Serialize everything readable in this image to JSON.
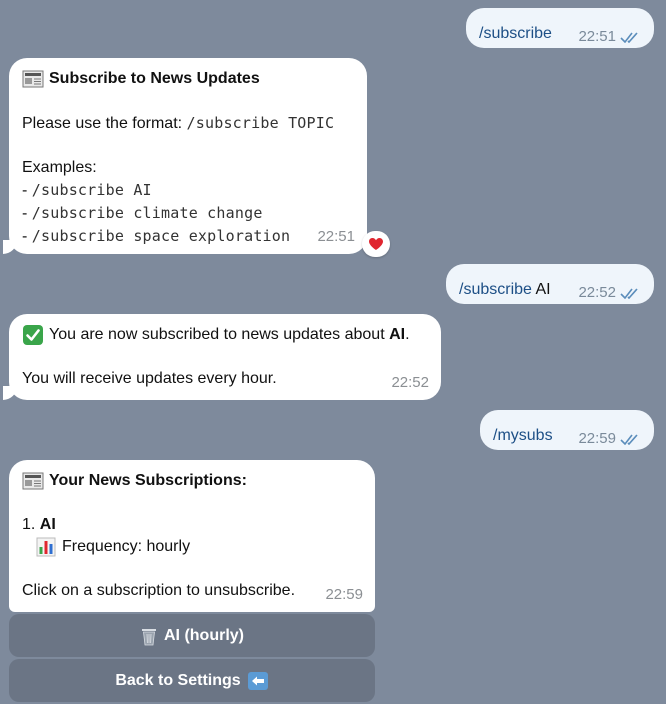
{
  "messages": {
    "m1": {
      "text": "/subscribe",
      "time": "22:51"
    },
    "m2": {
      "title": "Subscribe to News Updates",
      "intro": "Please use the format: ",
      "format": "/subscribe TOPIC",
      "examples_label": "Examples:",
      "examples": [
        "/subscribe AI",
        "/subscribe climate change",
        "/subscribe space exploration"
      ],
      "time": "22:51",
      "reaction": "heart"
    },
    "m3": {
      "command": "/subscribe",
      "arg": "AI",
      "time": "22:52"
    },
    "m4": {
      "line1_prefix": "You are now subscribed to news updates about ",
      "topic": "AI",
      "line1_suffix": ".",
      "line2": "You will receive updates every hour.",
      "time": "22:52"
    },
    "m5": {
      "text": "/mysubs",
      "time": "22:59"
    },
    "m6": {
      "title": "Your News Subscriptions:",
      "item_number": "1.",
      "item_topic": "AI",
      "frequency": "Frequency: hourly",
      "footer": "Click on a subscription to unsubscribe.",
      "time": "22:59"
    }
  },
  "buttons": {
    "sub_ai": "AI (hourly)",
    "back": "Back to Settings"
  },
  "icons": {
    "newspaper": "newspaper-icon",
    "check": "check-mark-icon",
    "chart": "bar-chart-icon",
    "trash": "wastebasket-icon",
    "back": "left-arrow-icon",
    "read": "double-check-icon",
    "heart": "heart-icon"
  },
  "colors": {
    "background": "#7e8a9c",
    "outgoing_bubble": "#eff5fb",
    "outgoing_text": "#1d4f86",
    "incoming_bubble": "#ffffff",
    "button": "#6b7585",
    "check_green": "#3aa54a",
    "heart_red": "#e0262f"
  }
}
